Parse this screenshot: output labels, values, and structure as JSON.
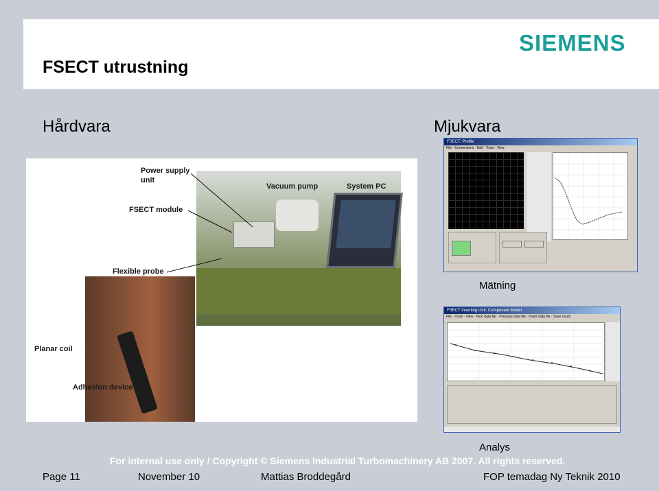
{
  "header": {
    "title": "FSECT utrustning",
    "logo": "SIEMENS"
  },
  "sections": {
    "hardware": "Hårdvara",
    "software": "Mjukvara"
  },
  "photo_labels": {
    "power_supply_line1": "Power supply",
    "power_supply_line2": "unit",
    "vacuum_pump": "Vacuum pump",
    "system_pc": "System PC",
    "fsect_module": "FSECT module",
    "flexible_probe": "Flexible probe",
    "planar_coil": "Planar coil",
    "adhesion_device": "Adhesion device"
  },
  "software_captions": {
    "measurement": "Mätning",
    "analysis": "Analys"
  },
  "footer": {
    "copyright": "For internal use only / Copyright © Siemens Industrial Turbomachinery AB 2007. All rights reserved.",
    "page": "Page 11",
    "date": "November 10",
    "author": "Mattias Broddegård",
    "event": "FOP temadag Ny Teknik 2010"
  },
  "colors": {
    "brand": "#1a9e9a",
    "background": "#c9ced6"
  }
}
